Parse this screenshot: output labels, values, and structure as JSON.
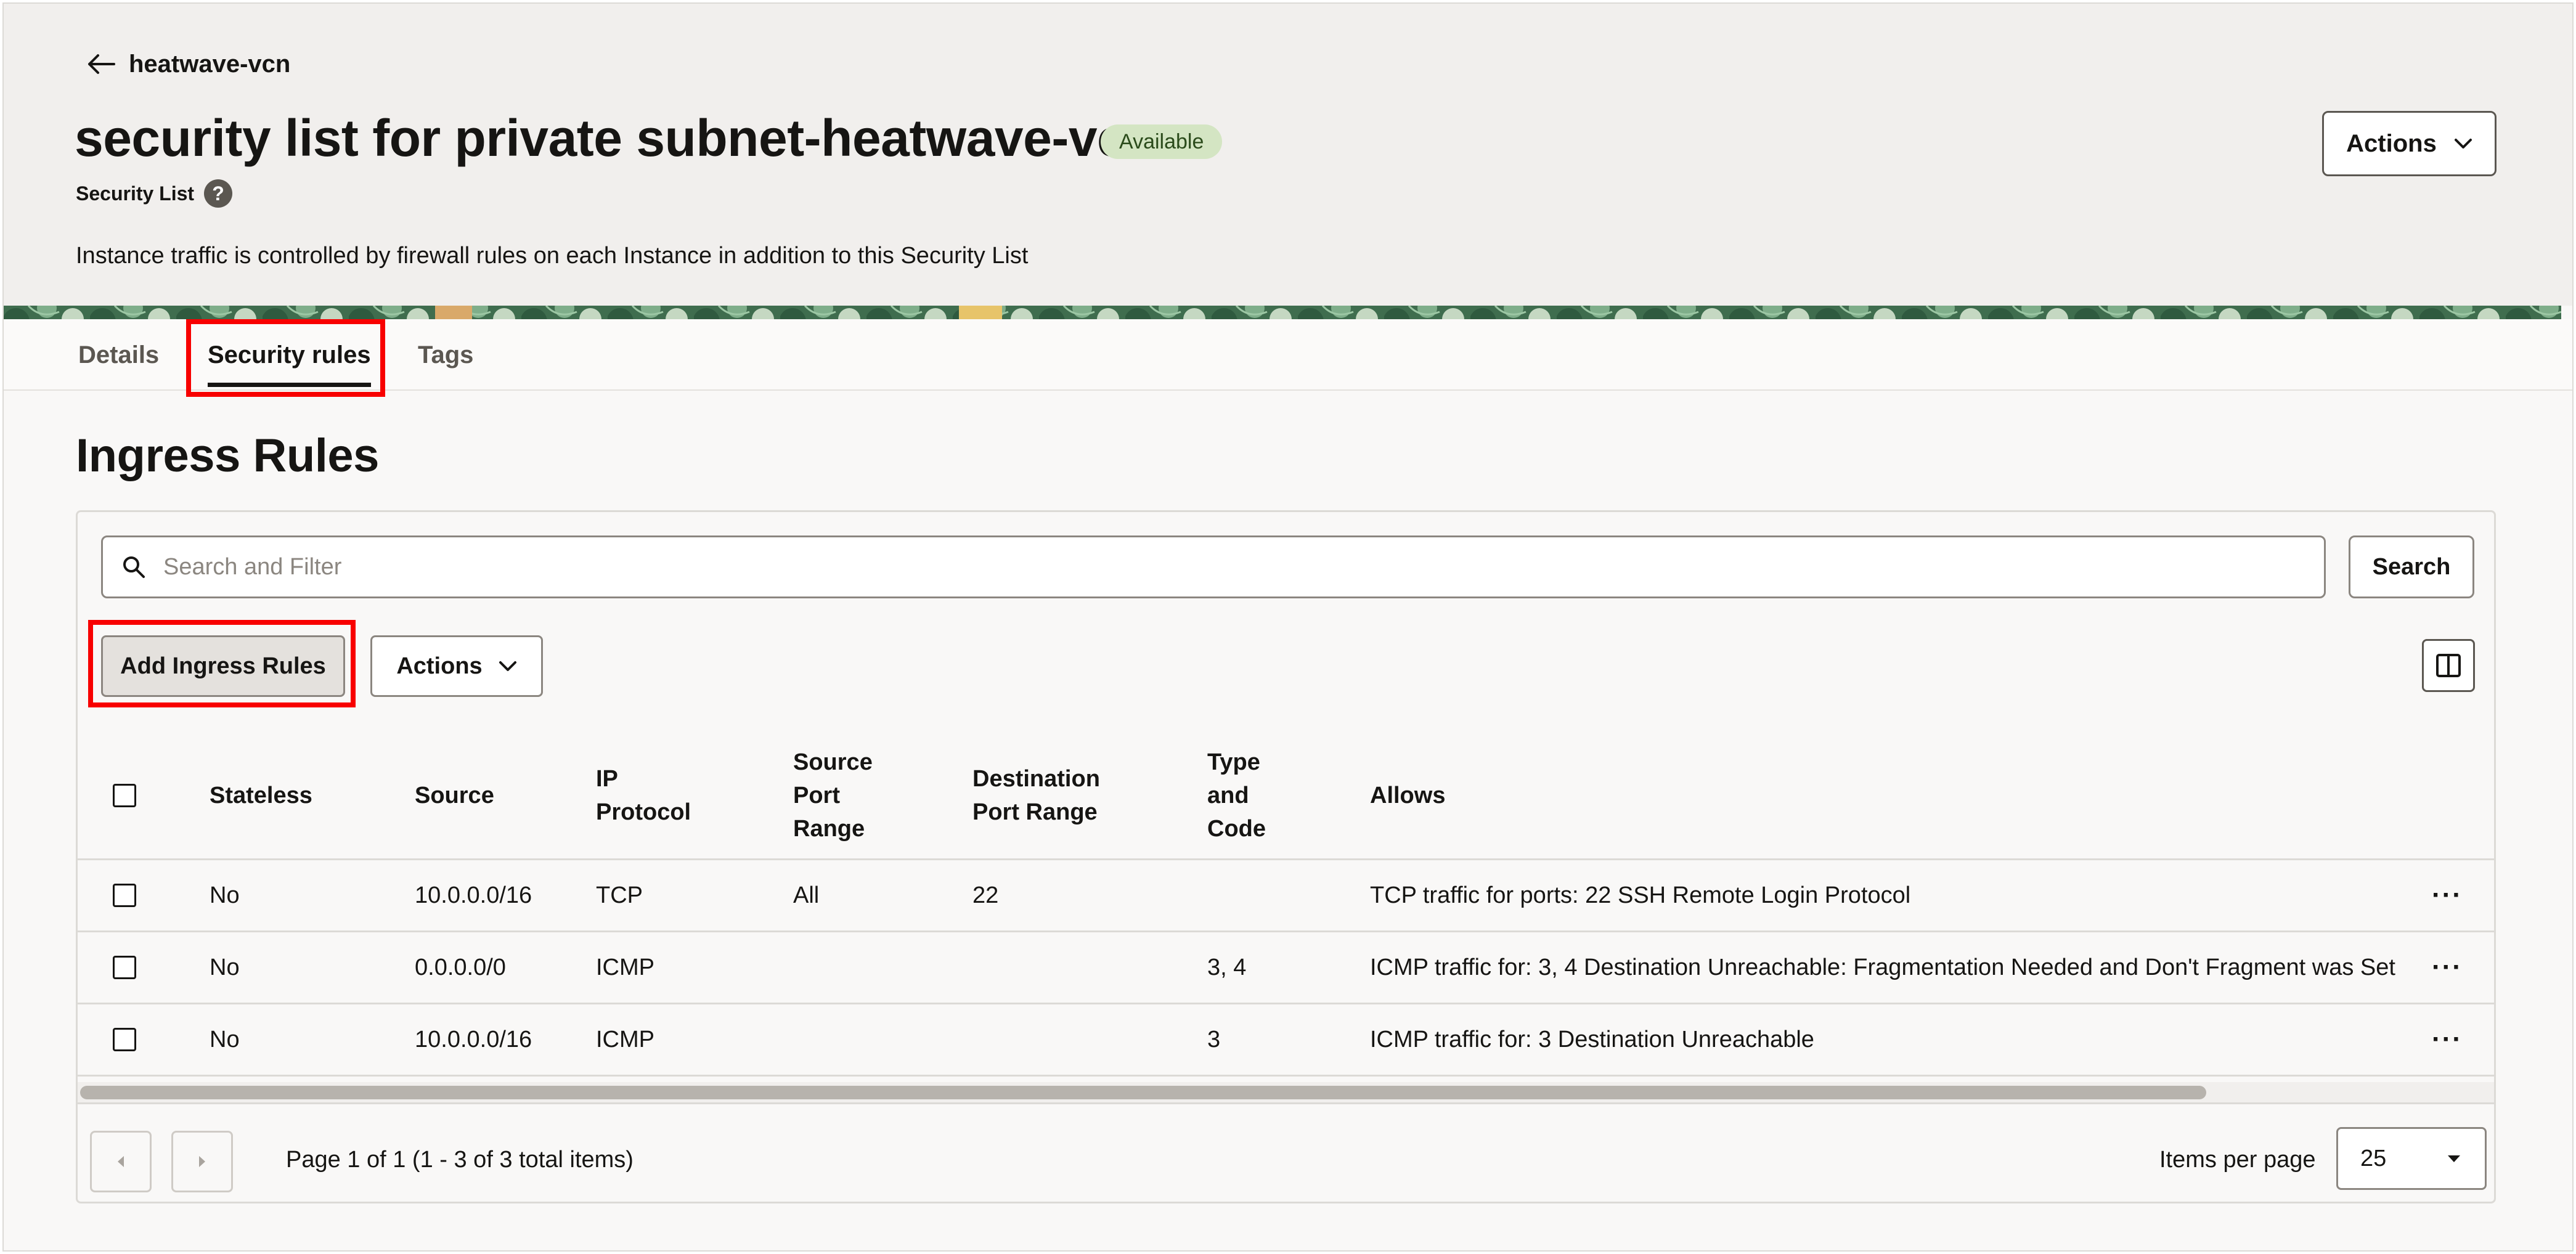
{
  "header": {
    "back_label": "heatwave-vcn",
    "title": "security list for private subnet-heatwave-vcn",
    "status": "Available",
    "resource_type": "Security List",
    "help_icon": "?",
    "description": "Instance traffic is controlled by firewall rules on each Instance in addition to this Security List",
    "actions_label": "Actions"
  },
  "tabs": [
    {
      "label": "Details",
      "active": false
    },
    {
      "label": "Security rules",
      "active": true
    },
    {
      "label": "Tags",
      "active": false
    }
  ],
  "section": {
    "title": "Ingress Rules",
    "search_placeholder": "Search and Filter",
    "search_button": "Search",
    "add_button": "Add Ingress Rules",
    "actions_label": "Actions"
  },
  "table": {
    "columns": [
      "Stateless",
      "Source",
      "IP Protocol",
      "Source Port Range",
      "Destination Port Range",
      "Type and Code",
      "Allows"
    ],
    "rows": [
      {
        "stateless": "No",
        "source": "10.0.0.0/16",
        "protocol": "TCP",
        "src_port": "All",
        "dst_port": "22",
        "type_code": "",
        "allows": "TCP traffic for ports: 22 SSH Remote Login Protocol"
      },
      {
        "stateless": "No",
        "source": "0.0.0.0/0",
        "protocol": "ICMP",
        "src_port": "",
        "dst_port": "",
        "type_code": "3, 4",
        "allows": "ICMP traffic for: 3, 4 Destination Unreachable: Fragmentation Needed and Don't Fragment was Set"
      },
      {
        "stateless": "No",
        "source": "10.0.0.0/16",
        "protocol": "ICMP",
        "src_port": "",
        "dst_port": "",
        "type_code": "3",
        "allows": "ICMP traffic for: 3 Destination Unreachable"
      }
    ],
    "row_menu": "···"
  },
  "pagination": {
    "info": "Page 1 of 1 (1 - 3 of 3 total items)",
    "items_per_page_label": "Items per page",
    "items_per_page_value": "25"
  },
  "colors": {
    "status_bg": "#d4e5c3",
    "highlight": "#f80000",
    "header_bg": "#f1efed"
  },
  "icons": [
    "back-arrow-icon",
    "help-icon",
    "chevron-down-icon",
    "search-icon",
    "columns-icon",
    "kebab-menu-icon",
    "prev-page-icon",
    "next-page-icon",
    "dropdown-caret-icon"
  ]
}
